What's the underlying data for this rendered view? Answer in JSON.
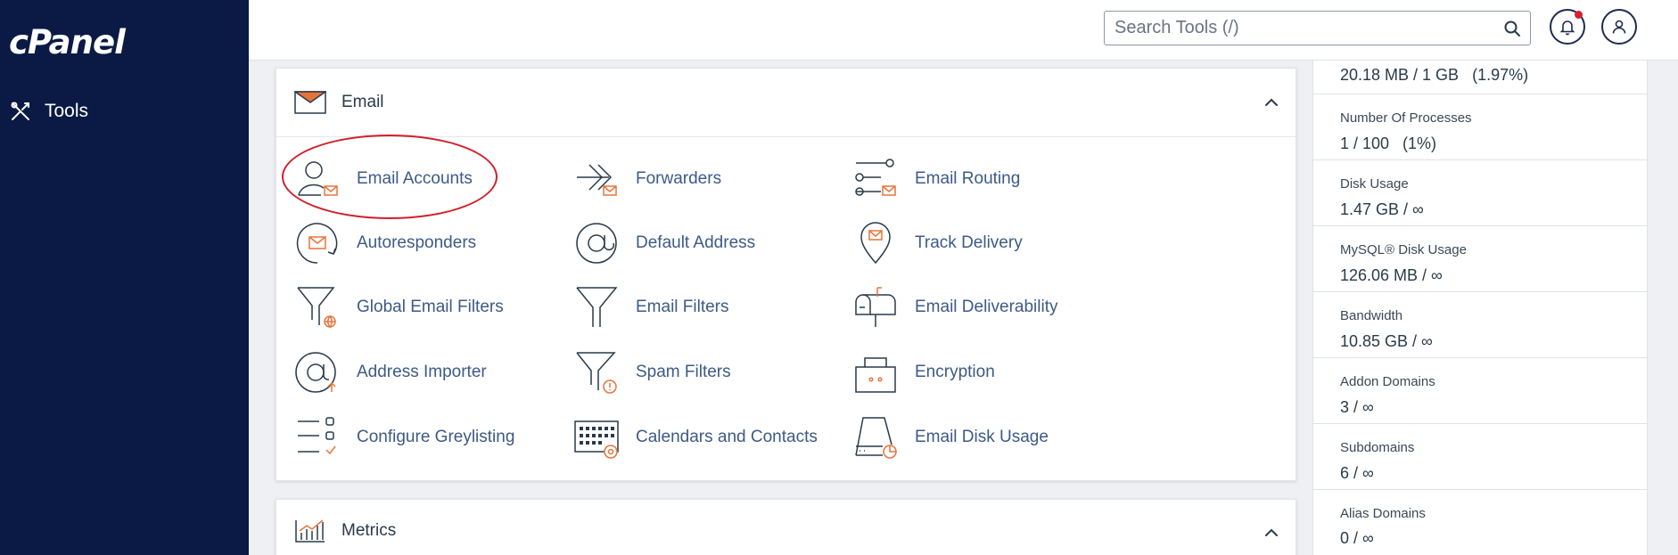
{
  "app": {
    "logo": "cPanel"
  },
  "sidebar": {
    "tools_label": "Tools"
  },
  "search": {
    "placeholder": "Search Tools (/)"
  },
  "email_section": {
    "title": "Email",
    "tools": [
      {
        "label": "Email Accounts",
        "icon": "email-accounts-icon"
      },
      {
        "label": "Forwarders",
        "icon": "forwarders-icon"
      },
      {
        "label": "Email Routing",
        "icon": "email-routing-icon"
      },
      {
        "label": "Autoresponders",
        "icon": "autoresponders-icon"
      },
      {
        "label": "Default Address",
        "icon": "default-address-icon"
      },
      {
        "label": "Track Delivery",
        "icon": "track-delivery-icon"
      },
      {
        "label": "Global Email Filters",
        "icon": "global-email-filters-icon"
      },
      {
        "label": "Email Filters",
        "icon": "email-filters-icon"
      },
      {
        "label": "Email Deliverability",
        "icon": "email-deliverability-icon"
      },
      {
        "label": "Address Importer",
        "icon": "address-importer-icon"
      },
      {
        "label": "Spam Filters",
        "icon": "spam-filters-icon"
      },
      {
        "label": "Encryption",
        "icon": "encryption-icon"
      },
      {
        "label": "Configure Greylisting",
        "icon": "configure-greylisting-icon"
      },
      {
        "label": "Calendars and Contacts",
        "icon": "calendars-contacts-icon"
      },
      {
        "label": "Email Disk Usage",
        "icon": "email-disk-usage-icon"
      }
    ]
  },
  "metrics_section": {
    "title": "Metrics"
  },
  "stats": [
    {
      "label": "",
      "value": "20.18 MB / 1 GB   (1.97%)"
    },
    {
      "label": "Number Of Processes",
      "value": "1 / 100   (1%)"
    },
    {
      "label": "Disk Usage",
      "value": "1.47 GB / ∞"
    },
    {
      "label": "MySQL® Disk Usage",
      "value": "126.06 MB / ∞"
    },
    {
      "label": "Bandwidth",
      "value": "10.85 GB / ∞"
    },
    {
      "label": "Addon Domains",
      "value": "3 / ∞"
    },
    {
      "label": "Subdomains",
      "value": "6 / ∞"
    },
    {
      "label": "Alias Domains",
      "value": "0 / ∞"
    }
  ],
  "colors": {
    "sidebar_bg": "#0b1a44",
    "accent_orange": "#e8733a",
    "link_blue": "#3c5a86",
    "highlight_red": "#d21e2b",
    "notification_dot": "#d9202e"
  }
}
